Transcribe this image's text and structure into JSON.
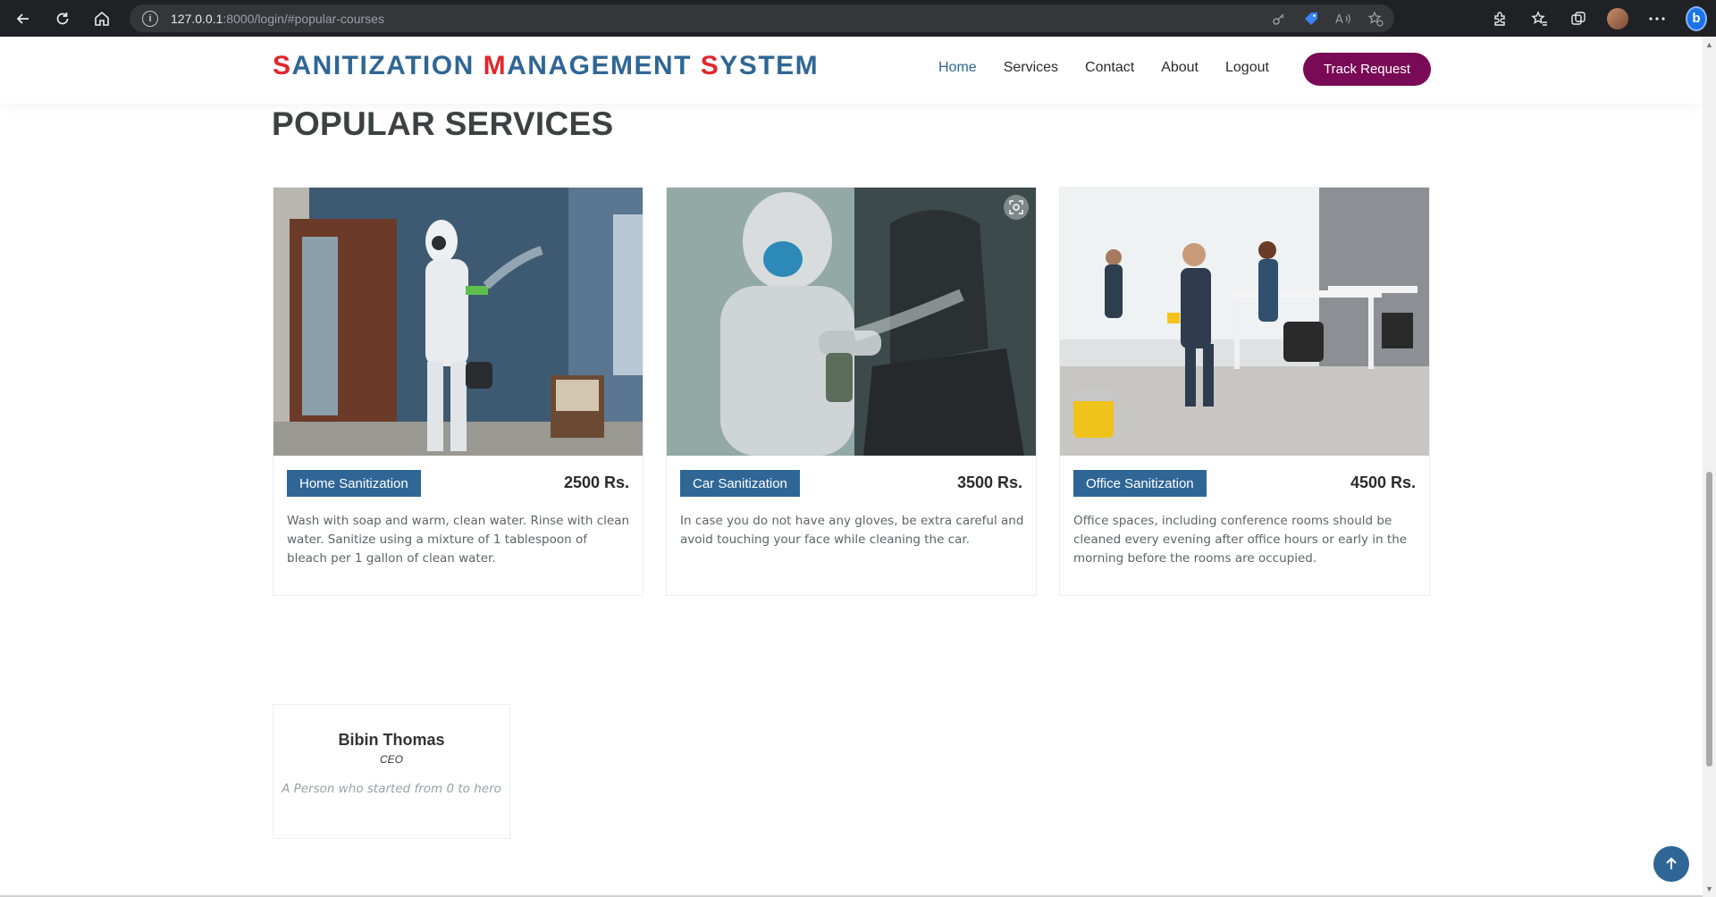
{
  "browser": {
    "url_host": "127.0.0.1",
    "url_rest": ":8000/login/#popular-courses"
  },
  "header": {
    "logo_words": [
      {
        "initial": "S",
        "rest": "ANITIZATION "
      },
      {
        "initial": "M",
        "rest": "ANAGEMENT "
      },
      {
        "initial": "S",
        "rest": "YSTEM"
      }
    ],
    "nav": [
      "Home",
      "Services",
      "Contact",
      "About",
      "Logout"
    ],
    "track_button": "Track Request"
  },
  "section": {
    "title": "POPULAR SERVICES"
  },
  "services": [
    {
      "tag": "Home Sanitization",
      "price": "2500 Rs.",
      "description": "Wash with soap and warm, clean water. Rinse with clean water. Sanitize using a mixture of 1 tablespoon of bleach per 1 gallon of clean water."
    },
    {
      "tag": "Car Sanitization",
      "price": "3500 Rs.",
      "description": "In case you do not have any gloves, be extra careful and avoid touching your face while cleaning the car."
    },
    {
      "tag": "Office Sanitization",
      "price": "4500 Rs.",
      "description": "Office spaces, including conference rooms should be cleaned every evening after office hours or early in the morning before the rooms are occupied."
    }
  ],
  "team": {
    "name": "Bibin Thomas",
    "role": "CEO",
    "quote": "A Person who started from 0 to hero"
  },
  "colors": {
    "brand_blue": "#2f6696",
    "brand_red": "#e0262b",
    "track_button_bg": "#790a55"
  }
}
